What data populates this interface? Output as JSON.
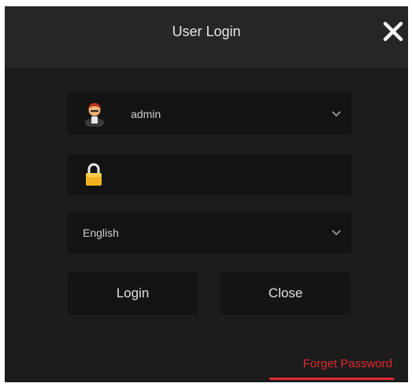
{
  "dialog": {
    "title": "User Login",
    "close_icon": "close-icon"
  },
  "username": {
    "value": "admin",
    "icon": "user-avatar-icon",
    "dropdown_icon": "chevron-down-icon"
  },
  "password": {
    "value": "",
    "icon": "lock-icon"
  },
  "language": {
    "selected": "English",
    "dropdown_icon": "chevron-down-icon"
  },
  "buttons": {
    "login_label": "Login",
    "close_label": "Close"
  },
  "forget_password": {
    "label": "Forget Password"
  },
  "colors": {
    "background": "#1c1c1c",
    "titlebar": "#262626",
    "field": "#131313",
    "accent": "#e0282e"
  }
}
